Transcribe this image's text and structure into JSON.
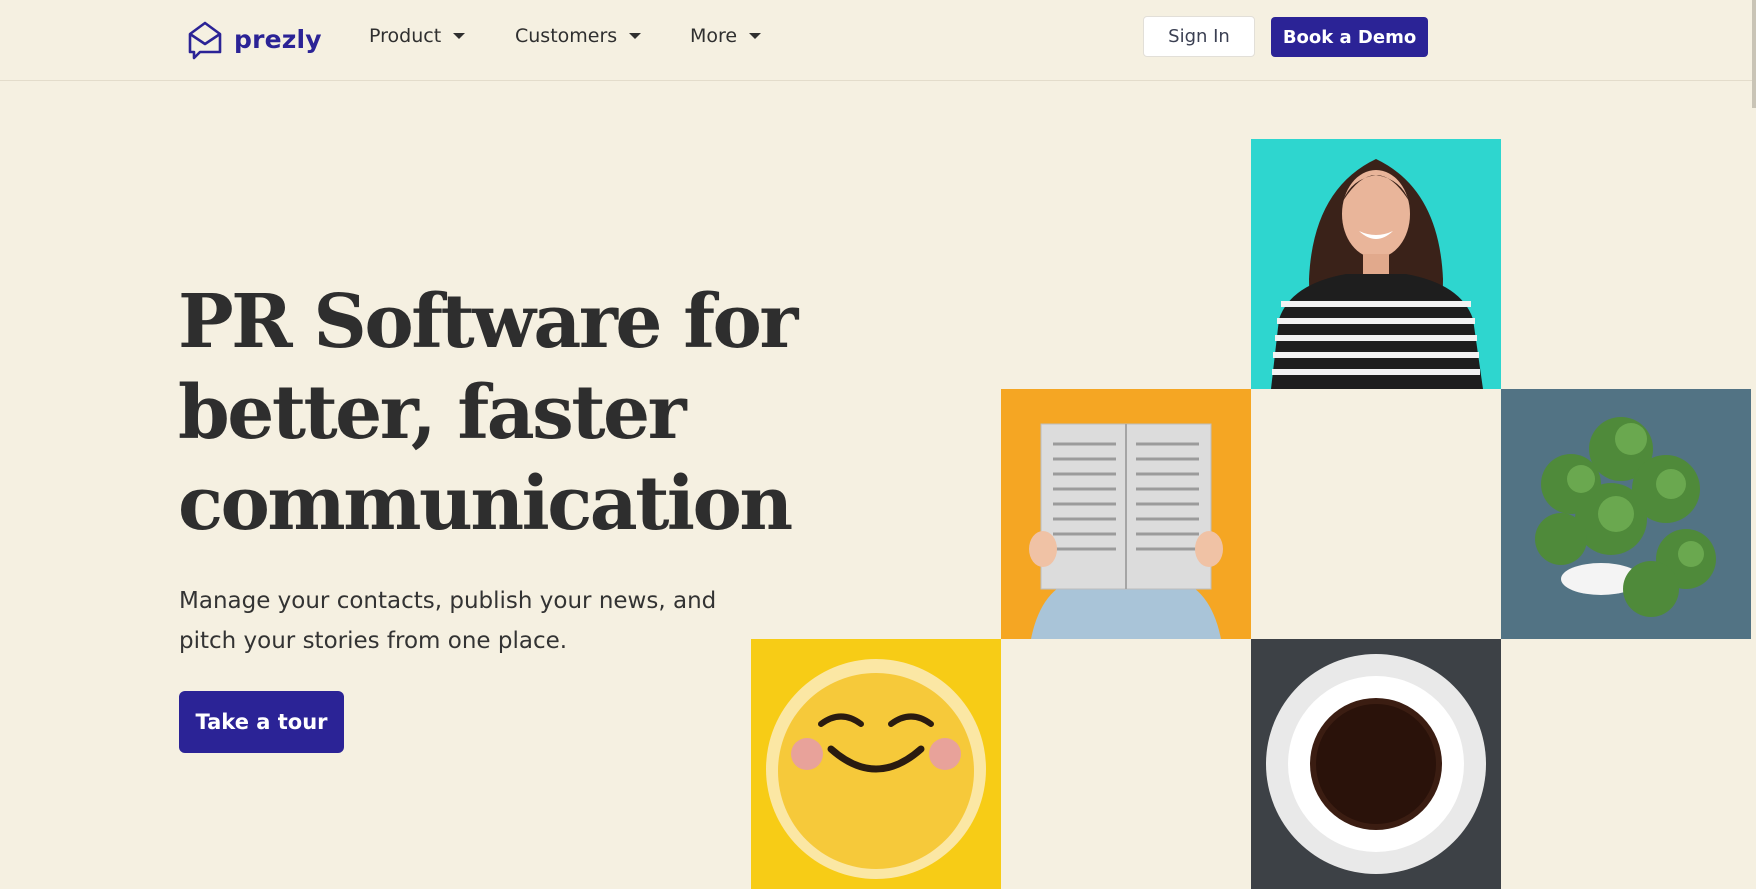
{
  "brand": {
    "name": "prezly",
    "color": "#2b2396"
  },
  "nav": {
    "items": [
      {
        "label": "Product",
        "icon": "chevron-down-icon"
      },
      {
        "label": "Customers",
        "icon": "chevron-down-icon"
      },
      {
        "label": "More",
        "icon": "chevron-down-icon"
      }
    ]
  },
  "header_actions": {
    "sign_in": "Sign In",
    "book_demo": "Book a Demo"
  },
  "hero": {
    "title_lines": [
      "PR Software for",
      "better, faster",
      "communication"
    ],
    "subtitle": "Manage your contacts, publish your news, and pitch your stories from one place.",
    "cta": "Take a tour"
  },
  "gallery": [
    {
      "subject": "laughing woman in striped shirt",
      "background": "#2ed6cf"
    },
    {
      "subject": "person reading newspaper",
      "background": "#f5a623"
    },
    {
      "subject": "potted plant from above",
      "background": "#527384"
    },
    {
      "subject": "smiling emoji pillow",
      "background": "#f7cc16"
    },
    {
      "subject": "cup of coffee",
      "background": "#3d4146"
    }
  ]
}
